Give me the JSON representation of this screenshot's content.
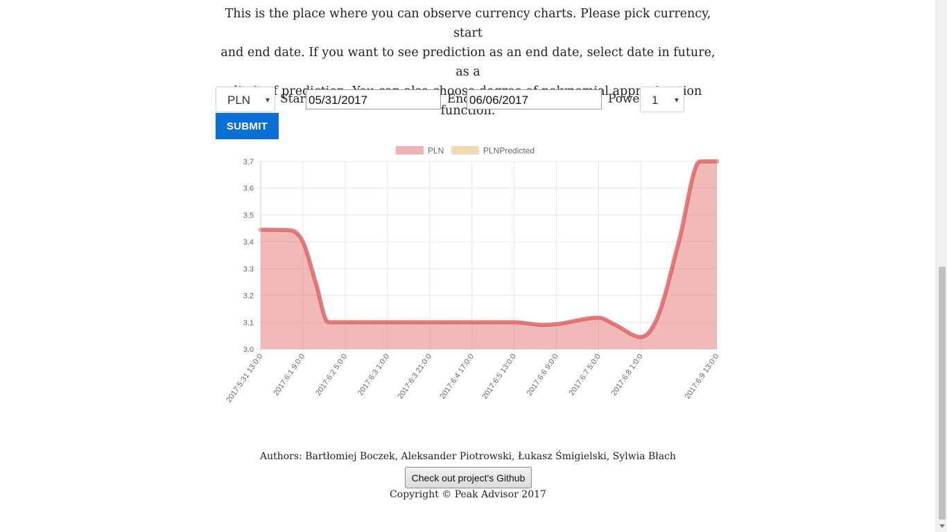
{
  "intro": {
    "line1": "This is the place where you can observe currency charts. Please pick currency, start",
    "line2": "and end date. If you want to see prediction as an end date, select date in future, as a",
    "line3": "limit of prediction. You can also choose degree of polynomial approximation function."
  },
  "form": {
    "currency": "PLN",
    "start_label": "Start",
    "start_value": "05/31/2017",
    "end_label": "End",
    "end_value": "06/06/2017",
    "power_label": "Power",
    "power_value": "1",
    "submit_label": "SUBMIT"
  },
  "chart_data": {
    "type": "area",
    "legend": [
      "PLN",
      "PLNPredicted"
    ],
    "legend_position": "top",
    "colors": {
      "PLN": "#e57373",
      "PLNPredicted": "#e8c07d"
    },
    "ylim": [
      3.0,
      3.7
    ],
    "yticks": [
      "3.7",
      "3.6",
      "3.5",
      "3.4",
      "3.3",
      "3.2",
      "3.1",
      "3.0"
    ],
    "xticks": [
      "2017:5:31 13:0:0",
      "2017:6:1 9:0:0",
      "2017:6:2 5:0:0",
      "2017:6:3 1:0:0",
      "2017:6:3 21:0:0",
      "2017:6:4 17:0:0",
      "2017:6:5 13:0:0",
      "2017:6:6 9:0:0",
      "2017:6:7 5:0:0",
      "2017:6:8 1:0:0",
      "2017:6:9 13:0:0"
    ],
    "grid": true,
    "series": [
      {
        "name": "PLN",
        "points": [
          [
            "2017:5:31 13:0:0",
            3.445
          ],
          [
            "2017:6:1 3:0:0",
            3.443
          ],
          [
            "2017:6:1 9:0:0",
            3.4
          ],
          [
            "2017:6:1 15:0:0",
            3.25
          ],
          [
            "2017:6:1 21:0:0",
            3.1
          ],
          [
            "2017:6:2 5:0:0",
            3.1
          ],
          [
            "2017:6:3 1:0:0",
            3.1
          ],
          [
            "2017:6:3 21:0:0",
            3.1
          ],
          [
            "2017:6:4 17:0:0",
            3.1
          ],
          [
            "2017:6:5 13:0:0",
            3.1
          ],
          [
            "2017:6:6 3:0:0",
            3.09
          ],
          [
            "2017:6:6 9:0:0",
            3.093
          ],
          [
            "2017:6:7 5:0:0",
            3.117
          ],
          [
            "2017:6:7 13:0:0",
            3.09
          ],
          [
            "2017:6:8 1:0:0",
            3.045
          ],
          [
            "2017:6:8 9:0:0",
            3.12
          ],
          [
            "2017:6:8 19:0:0",
            3.4
          ],
          [
            "2017:6:9 5:0:0",
            3.7
          ],
          [
            "2017:6:9 13:0:0",
            3.7
          ]
        ]
      },
      {
        "name": "PLNPredicted",
        "points": []
      }
    ]
  },
  "footer": {
    "authors": "Authors: Bartłomiej Boczek, Aleksander Piotrowski, Łukasz Śmigielski, Sylwia Błach",
    "github_label": "Check out project's Github",
    "copyright": "Copyright © Peak Advisor 2017"
  }
}
